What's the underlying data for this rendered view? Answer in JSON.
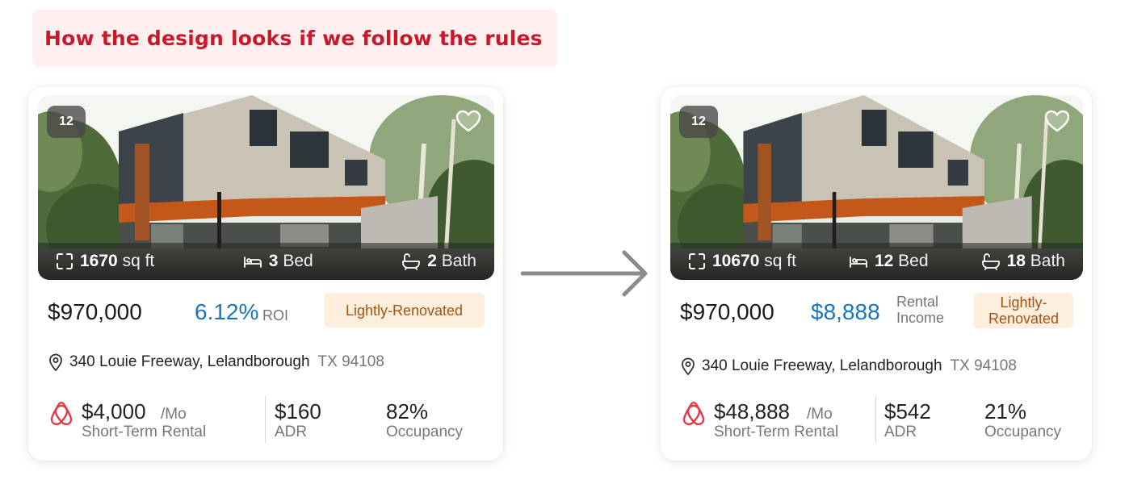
{
  "banner": {
    "title": "How the design looks if we follow the rules"
  },
  "colors": {
    "brand_red": "#c8192b",
    "accent_blue": "#1a75bb",
    "tag_text": "#a05418",
    "tag_bg": "#fdeedd"
  },
  "icons": [
    "expand-icon",
    "bed-icon",
    "bath-icon",
    "heart-icon",
    "location-pin-icon",
    "airbnb-icon",
    "arrow-right-icon"
  ],
  "cards": [
    {
      "photo_count": "12",
      "sqft": "1670",
      "sqft_unit": "sq ft",
      "beds": "3",
      "beds_unit": "Bed",
      "baths": "2",
      "baths_unit": "Bath",
      "price": "$970,000",
      "metric_value": "6.12%",
      "metric_label": "ROI",
      "tag": "Lightly-Renovated",
      "address_street": "340 Louie Freeway, Lelandborough",
      "address_zip": "TX 94108",
      "rental_value": "$4,000",
      "rental_period": "/Mo",
      "rental_label": "Short-Term Rental",
      "adr_value": "$160",
      "adr_label": "ADR",
      "occupancy_value": "82%",
      "occupancy_label": "Occupancy"
    },
    {
      "photo_count": "12",
      "sqft": "10670",
      "sqft_unit": "sq ft",
      "beds": "12",
      "beds_unit": "Bed",
      "baths": "18",
      "baths_unit": "Bath",
      "price": "$970,000",
      "metric_value": "$8,888",
      "metric_label_line1": "Rental",
      "metric_label_line2": "Income",
      "tag_line1": "Lightly-",
      "tag_line2": "Renovated",
      "address_street": "340 Louie Freeway, Lelandborough",
      "address_zip": "TX 94108",
      "rental_value": "$48,888",
      "rental_period": "/Mo",
      "rental_label": "Short-Term Rental",
      "adr_value": "$542",
      "adr_label": "ADR",
      "occupancy_value": "21%",
      "occupancy_label": "Occupancy"
    }
  ]
}
